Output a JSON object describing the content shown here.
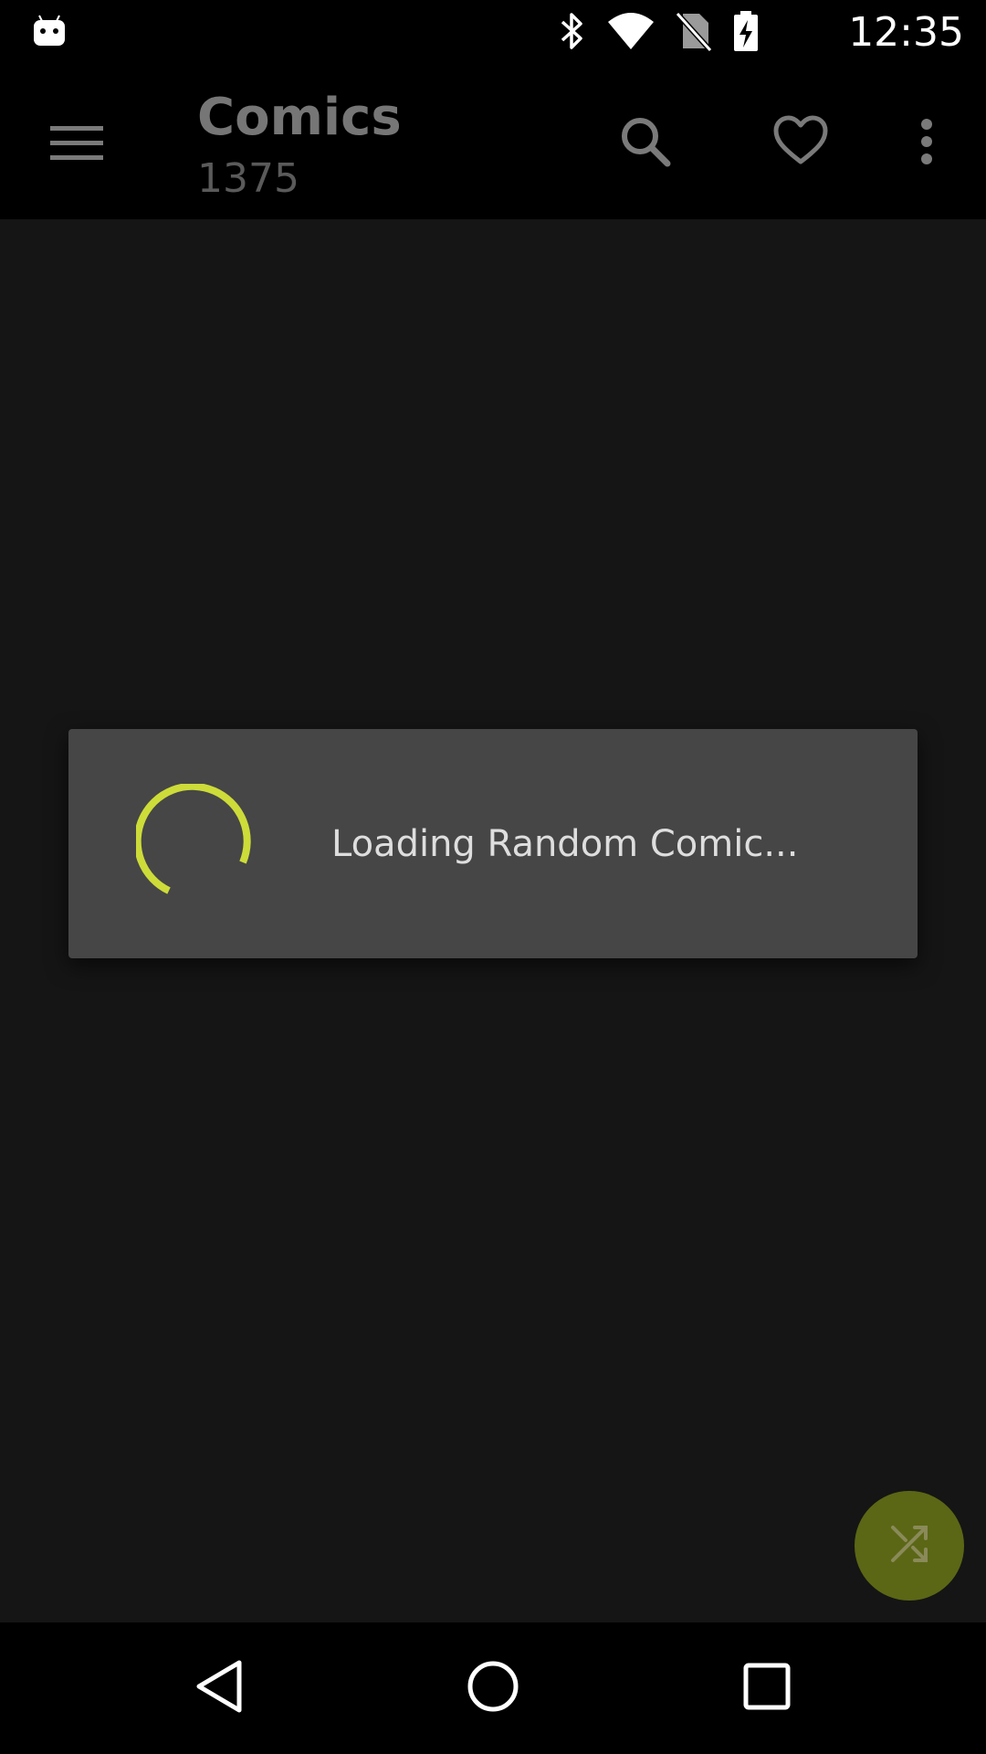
{
  "status_bar": {
    "time": "12:35",
    "icons": [
      "android-icon",
      "bluetooth-icon",
      "wifi-icon",
      "no-sim-icon",
      "battery-charging-icon"
    ]
  },
  "toolbar": {
    "title": "Comics",
    "subtitle": "1375",
    "icons": [
      "menu-icon",
      "search-icon",
      "heart-icon",
      "more-vert-icon"
    ]
  },
  "dialog": {
    "message": "Loading Random Comic..."
  },
  "fab": {
    "icon": "shuffle-icon"
  },
  "nav_bar": {
    "icons": [
      "back-icon",
      "home-icon",
      "recents-icon"
    ]
  },
  "colors": {
    "accent": "#cddc39",
    "fab": "#5b6715",
    "dialog_bg": "#464646",
    "background": "#151515"
  }
}
